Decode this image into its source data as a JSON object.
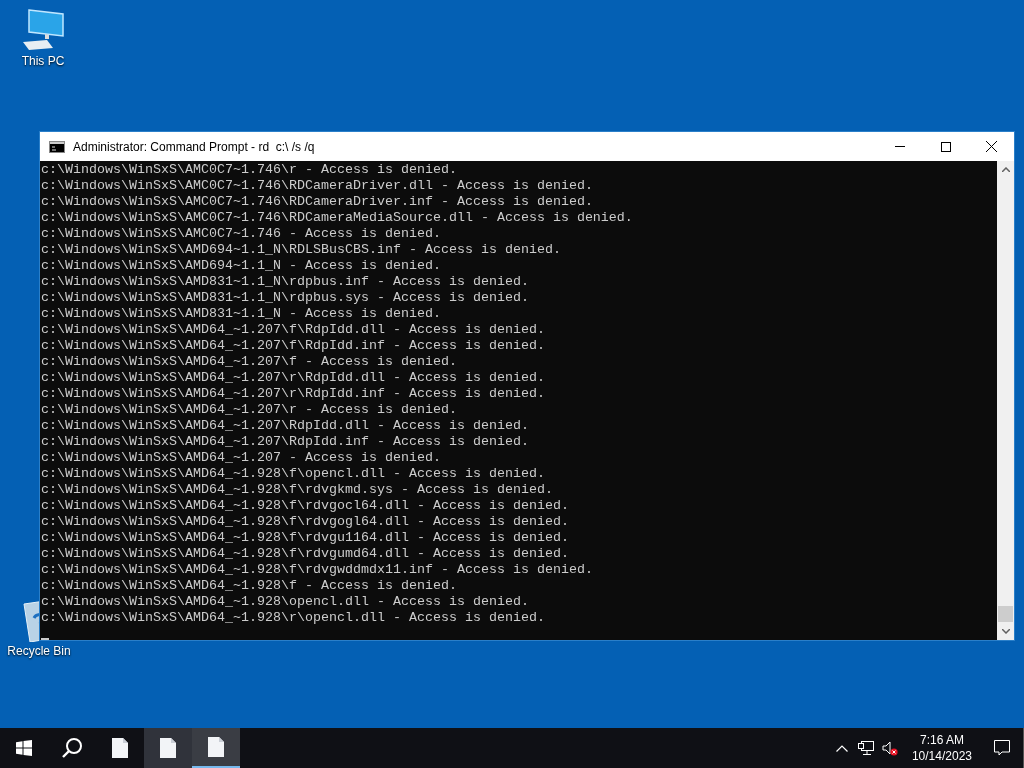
{
  "desktop_icons": [
    {
      "kind": "computer",
      "label": "This PC"
    },
    {
      "kind": "recycle",
      "label": "Recycle Bin"
    }
  ],
  "window": {
    "title": "Administrator: Command Prompt - rd  c:\\ /s /q",
    "lines": [
      "c:\\Windows\\WinSxS\\AMC0C7~1.746\\r - Access is denied.",
      "c:\\Windows\\WinSxS\\AMC0C7~1.746\\RDCameraDriver.dll - Access is denied.",
      "c:\\Windows\\WinSxS\\AMC0C7~1.746\\RDCameraDriver.inf - Access is denied.",
      "c:\\Windows\\WinSxS\\AMC0C7~1.746\\RDCameraMediaSource.dll - Access is denied.",
      "c:\\Windows\\WinSxS\\AMC0C7~1.746 - Access is denied.",
      "c:\\Windows\\WinSxS\\AMD694~1.1_N\\RDLSBusCBS.inf - Access is denied.",
      "c:\\Windows\\WinSxS\\AMD694~1.1_N - Access is denied.",
      "c:\\Windows\\WinSxS\\AMD831~1.1_N\\rdpbus.inf - Access is denied.",
      "c:\\Windows\\WinSxS\\AMD831~1.1_N\\rdpbus.sys - Access is denied.",
      "c:\\Windows\\WinSxS\\AMD831~1.1_N - Access is denied.",
      "c:\\Windows\\WinSxS\\AMD64_~1.207\\f\\RdpIdd.dll - Access is denied.",
      "c:\\Windows\\WinSxS\\AMD64_~1.207\\f\\RdpIdd.inf - Access is denied.",
      "c:\\Windows\\WinSxS\\AMD64_~1.207\\f - Access is denied.",
      "c:\\Windows\\WinSxS\\AMD64_~1.207\\r\\RdpIdd.dll - Access is denied.",
      "c:\\Windows\\WinSxS\\AMD64_~1.207\\r\\RdpIdd.inf - Access is denied.",
      "c:\\Windows\\WinSxS\\AMD64_~1.207\\r - Access is denied.",
      "c:\\Windows\\WinSxS\\AMD64_~1.207\\RdpIdd.dll - Access is denied.",
      "c:\\Windows\\WinSxS\\AMD64_~1.207\\RdpIdd.inf - Access is denied.",
      "c:\\Windows\\WinSxS\\AMD64_~1.207 - Access is denied.",
      "c:\\Windows\\WinSxS\\AMD64_~1.928\\f\\opencl.dll - Access is denied.",
      "c:\\Windows\\WinSxS\\AMD64_~1.928\\f\\rdvgkmd.sys - Access is denied.",
      "c:\\Windows\\WinSxS\\AMD64_~1.928\\f\\rdvgocl64.dll - Access is denied.",
      "c:\\Windows\\WinSxS\\AMD64_~1.928\\f\\rdvgogl64.dll - Access is denied.",
      "c:\\Windows\\WinSxS\\AMD64_~1.928\\f\\rdvgu1164.dll - Access is denied.",
      "c:\\Windows\\WinSxS\\AMD64_~1.928\\f\\rdvgumd64.dll - Access is denied.",
      "c:\\Windows\\WinSxS\\AMD64_~1.928\\f\\rdvgwddmdx11.inf - Access is denied.",
      "c:\\Windows\\WinSxS\\AMD64_~1.928\\f - Access is denied.",
      "c:\\Windows\\WinSxS\\AMD64_~1.928\\opencl.dll - Access is denied.",
      "c:\\Windows\\WinSxS\\AMD64_~1.928\\r\\opencl.dll - Access is denied."
    ]
  },
  "taskbar": {
    "items": [
      {
        "kind": "start",
        "selected": false,
        "hovered": false
      },
      {
        "kind": "search",
        "selected": false,
        "hovered": false
      },
      {
        "kind": "app",
        "selected": false,
        "hovered": false
      },
      {
        "kind": "app",
        "selected": false,
        "hovered": true
      },
      {
        "kind": "app",
        "selected": true,
        "hovered": false
      }
    ],
    "tray": {
      "volume_muted": true,
      "time": "7:16 AM",
      "date": "10/14/2023"
    }
  }
}
